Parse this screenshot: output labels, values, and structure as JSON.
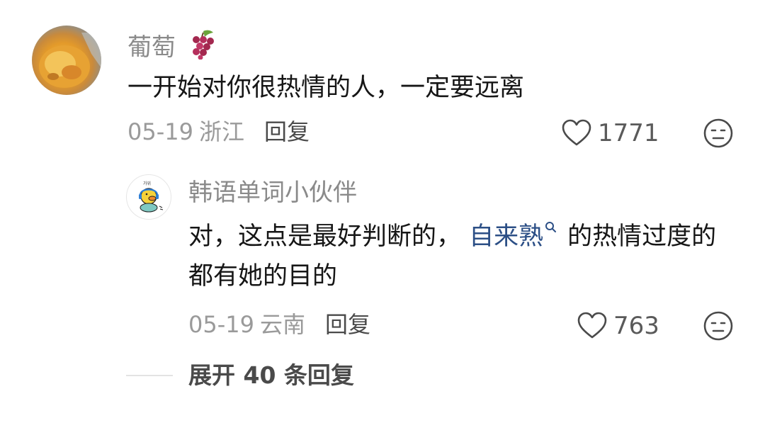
{
  "comments": [
    {
      "username": "葡萄",
      "username_emoji": "🍇",
      "text": "一开始对你很热情的人，一定要远离",
      "date": "05-19",
      "location": "浙江",
      "reply_label": "回复",
      "likes": "1771"
    }
  ],
  "reply": {
    "username": "韩语单词小伙伴",
    "text_before": "对，这点是最好判断的，",
    "link_text": "自来熟",
    "text_after": "的热情过度的都有她的目的",
    "date": "05-19",
    "location": "云南",
    "reply_label": "回复",
    "likes": "763",
    "avatar_text": "가위"
  },
  "expand": {
    "label": "展开 40 条回复"
  },
  "colors": {
    "link": "#2c4f86",
    "muted": "#9a9a9a",
    "username": "#8a8a8a"
  }
}
